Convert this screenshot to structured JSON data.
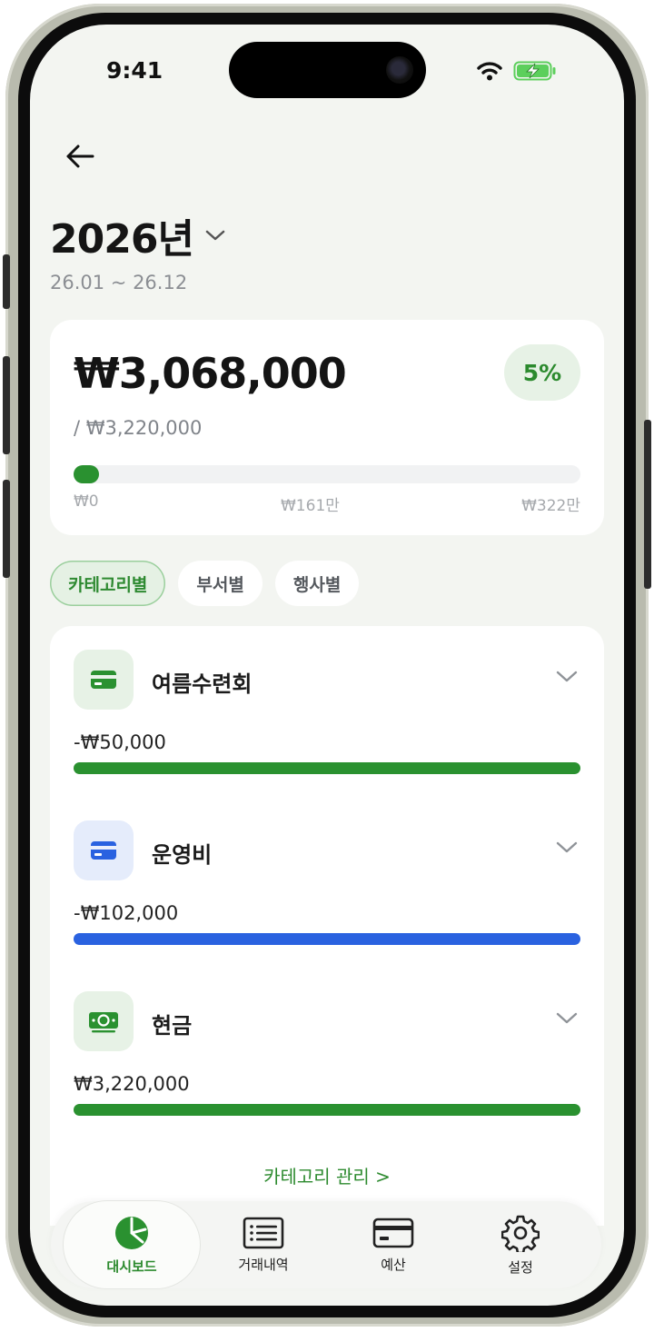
{
  "status_bar": {
    "time": "9:41"
  },
  "header": {
    "year_title": "2026년",
    "period": "26.01 ~ 26.12"
  },
  "summary": {
    "total": "₩3,068,000",
    "budget": "/ ₩3,220,000",
    "percent": "5%",
    "progress_fraction": 0.05,
    "scale": {
      "min": "₩0",
      "mid": "₩161만",
      "max": "₩322만"
    }
  },
  "tabs": [
    {
      "label": "카테고리별",
      "active": true
    },
    {
      "label": "부서별",
      "active": false
    },
    {
      "label": "행사별",
      "active": false
    }
  ],
  "categories": [
    {
      "name": "여름수련회",
      "amount": "-₩50,000",
      "icon": "card-icon",
      "color": "#2a9130",
      "icon_bg": "#e7f2e6"
    },
    {
      "name": "운영비",
      "amount": "-₩102,000",
      "icon": "card-icon",
      "color": "#2a62e0",
      "icon_bg": "#e5ecfb"
    },
    {
      "name": "현금",
      "amount": "₩3,220,000",
      "icon": "cash-icon",
      "color": "#2a9130",
      "icon_bg": "#e7f2e6"
    }
  ],
  "manage_link": "카테고리 관리 >",
  "bottom_nav": [
    {
      "label": "대시보드",
      "icon": "pie-chart-icon",
      "active": true
    },
    {
      "label": "거래내역",
      "icon": "list-icon",
      "active": false
    },
    {
      "label": "예산",
      "icon": "card-icon",
      "active": false
    },
    {
      "label": "설정",
      "icon": "gear-icon",
      "active": false
    }
  ],
  "colors": {
    "accent": "#2c8a2e",
    "blue": "#2a62e0",
    "background": "#f3f5f1"
  }
}
